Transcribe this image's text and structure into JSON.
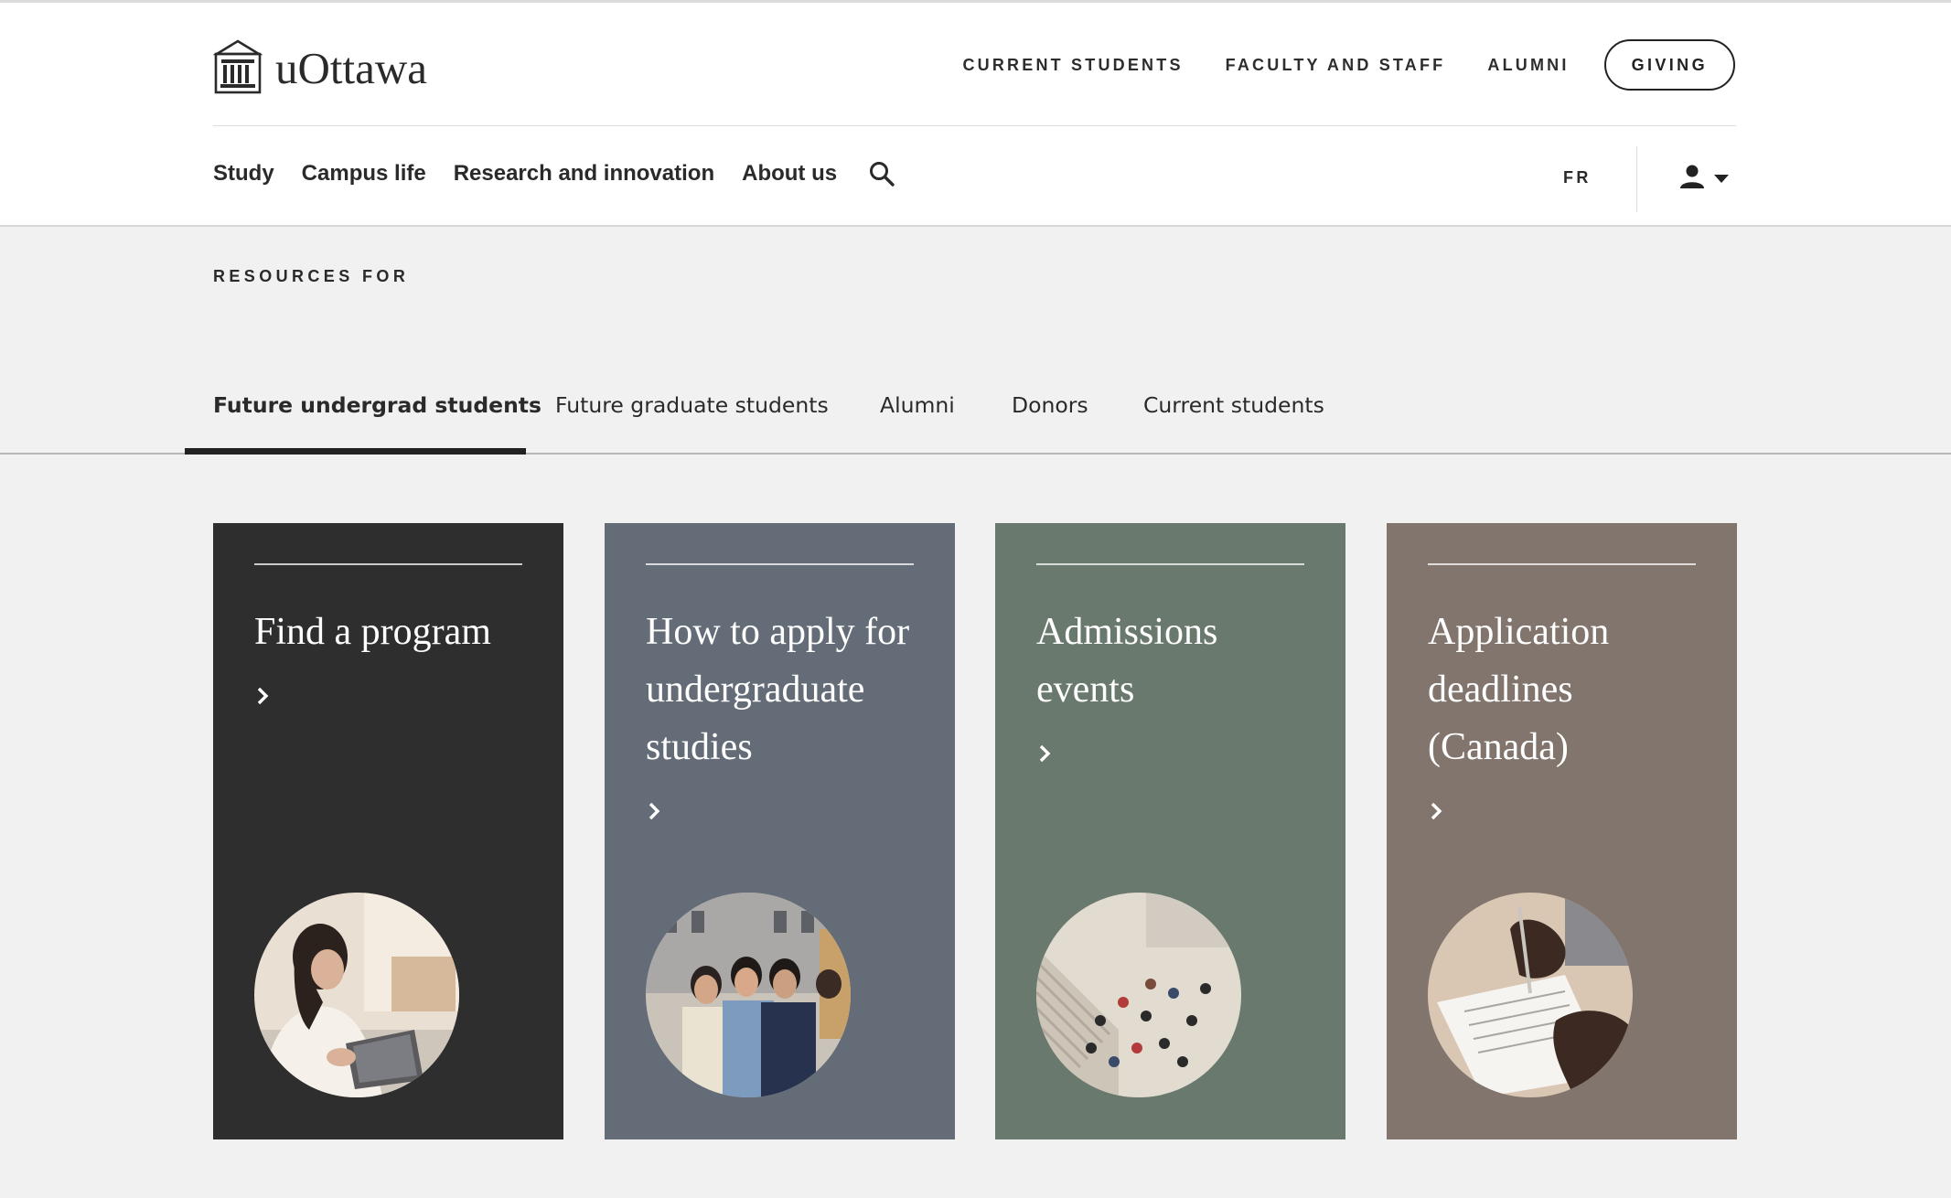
{
  "header": {
    "logo_text": "uOttawa",
    "utility_nav": [
      "CURRENT STUDENTS",
      "FACULTY AND STAFF",
      "ALUMNI"
    ],
    "giving_label": "GIVING",
    "main_nav": [
      "Study",
      "Campus life",
      "Research and innovation",
      "About us"
    ],
    "language_toggle": "FR"
  },
  "resources": {
    "label": "RESOURCES FOR",
    "tabs": [
      "Future undergrad students",
      "Future graduate students",
      "Alumni",
      "Donors",
      "Current students"
    ],
    "active_tab": "Future undergrad students"
  },
  "cards": [
    {
      "title": "Find a program",
      "background": "#2e2e2e",
      "photo": "woman-with-laptop"
    },
    {
      "title": "How to apply for undergraduate studies",
      "background": "#636c77",
      "photo": "group-of-students"
    },
    {
      "title": "Admissions events",
      "background": "#69796d",
      "photo": "campus-crowd-aerial"
    },
    {
      "title": "Application deadlines (Canada)",
      "background": "#82756d",
      "photo": "hand-signing-document"
    }
  ],
  "colors": {
    "page_background": "#f1f1f1",
    "header_background": "#ffffff",
    "text_dark": "#222222"
  }
}
